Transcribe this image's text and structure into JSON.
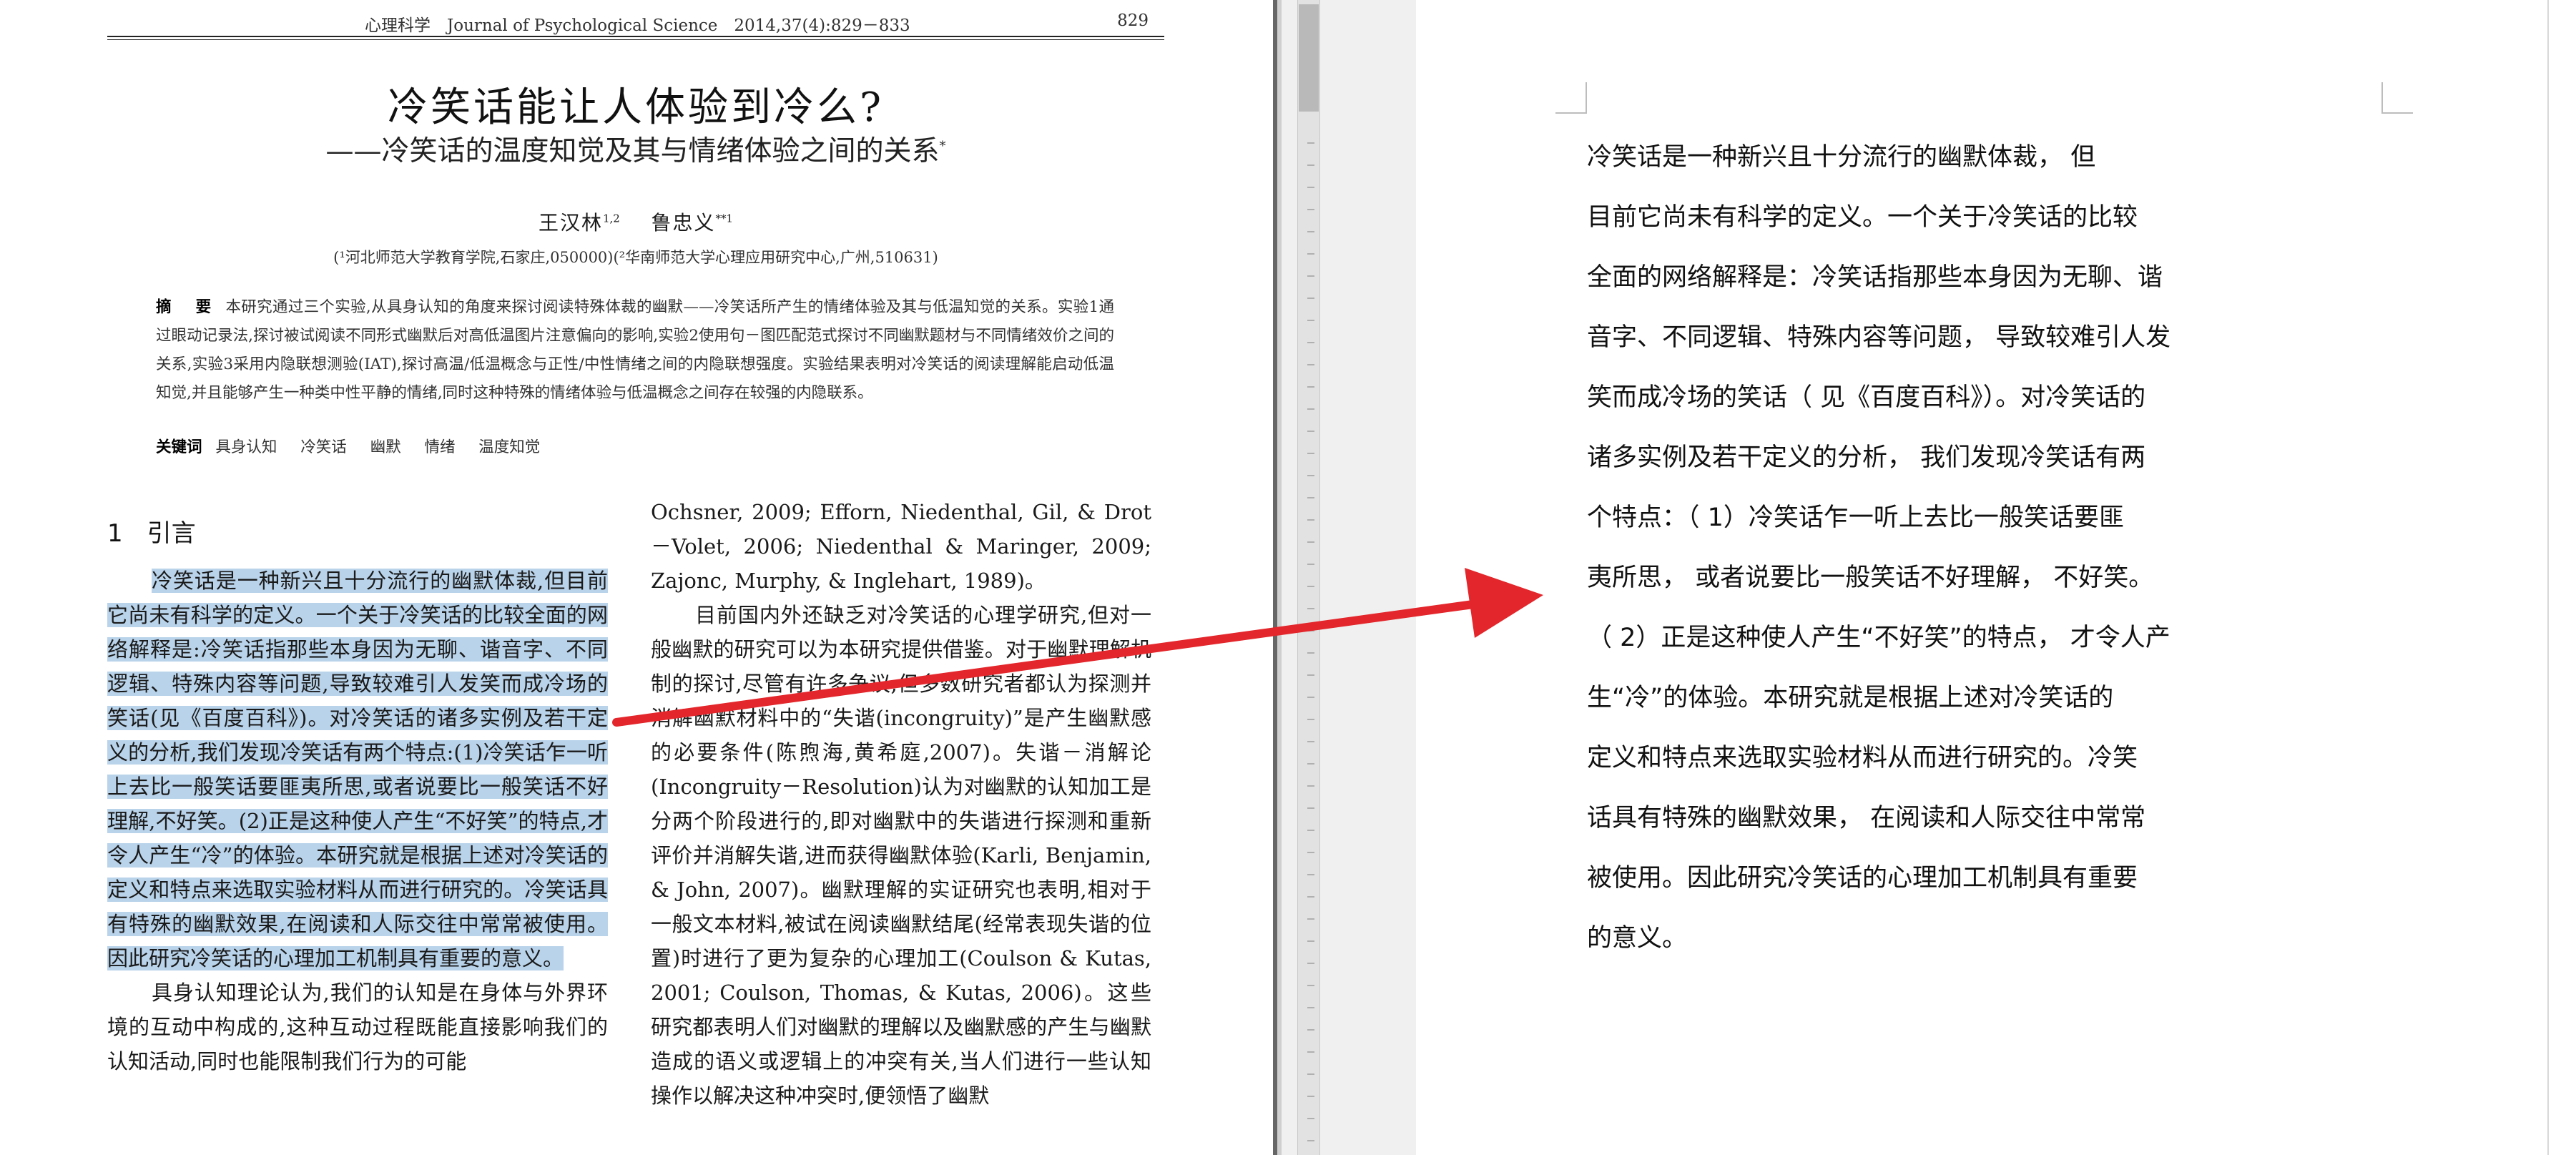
{
  "pdf": {
    "header": {
      "journal_line": "心理科学　Journal of Psychological Science　2014,37(4):829－833",
      "page_number": "829"
    },
    "title": "冷笑话能让人体验到冷么?",
    "subtitle": "——冷笑话的温度知觉及其与情绪体验之间的关系",
    "subtitle_mark": "*",
    "authors": {
      "first": "王汉林",
      "first_sup": "1,2",
      "second": "鲁忠义",
      "second_sup": "**1"
    },
    "affiliations": "(¹河北师范大学教育学院,石家庄,050000)(²华南师范大学心理应用研究中心,广州,510631)",
    "abstract_label": "摘　要",
    "abstract": "本研究通过三个实验,从具身认知的角度来探讨阅读特殊体裁的幽默——冷笑话所产生的情绪体验及其与低温知觉的关系。实验1通过眼动记录法,探讨被试阅读不同形式幽默后对高低温图片注意偏向的影响,实验2使用句－图匹配范式探讨不同幽默题材与不同情绪效价之间的关系,实验3采用内隐联想测验(IAT),探讨高温/低温概念与正性/中性情绪之间的内隐联想强度。实验结果表明对冷笑话的阅读理解能启动低温知觉,并且能够产生一种类中性平静的情绪,同时这种特殊的情绪体验与低温概念之间存在较强的内隐联系。",
    "keywords_label": "关键词",
    "keywords": [
      "具身认知",
      "冷笑话",
      "幽默",
      "情绪",
      "温度知觉"
    ],
    "section_heading": "1　引言",
    "left_col": {
      "highlighted_para": "冷笑话是一种新兴且十分流行的幽默体裁,但目前它尚未有科学的定义。一个关于冷笑话的比较全面的网络解释是:冷笑话指那些本身因为无聊、谐音字、不同逻辑、特殊内容等问题,导致较难引人发笑而成冷场的笑话(见《百度百科》)。对冷笑话的诸多实例及若干定义的分析,我们发现冷笑话有两个特点:(1)冷笑话乍一听上去比一般笑话要匪夷所思,或者说要比一般笑话不好理解,不好笑。(2)正是这种使人产生“不好笑”的特点,才令人产生“冷”的体验。本研究就是根据上述对冷笑话的定义和特点来选取实验材料从而进行研究的。冷笑话具有特殊的幽默效果,在阅读和人际交往中常常被使用。因此研究冷笑话的心理加工机制具有重要的意义。",
      "next_para": "具身认知理论认为,我们的认知是在身体与外界环境的互动中构成的,这种互动过程既能直接影响我们的认知活动,同时也能限制我们行为的可能"
    },
    "right_col": {
      "para1": "Ochsner, 2009; Efforn, Niedenthal, Gil, & Drot－Volet, 2006; Niedenthal & Maringer, 2009; Zajonc, Murphy, & Inglehart, 1989)。",
      "para2": "目前国内外还缺乏对冷笑话的心理学研究,但对一般幽默的研究可以为本研究提供借鉴。对于幽默理解机制的探讨,尽管有许多争议,但多数研究者都认为探测并消解幽默材料中的“失谐(incongruity)”是产生幽默感的必要条件(陈煦海,黄希庭,2007)。失谐－消解论(Incongruity－Resolution)认为对幽默的认知加工是分两个阶段进行的,即对幽默中的失谐进行探测和重新评价并消解失谐,进而获得幽默体验(Karli, Benjamin, & John, 2007)。幽默理解的实证研究也表明,相对于一般文本材料,被试在阅读幽默结尾(经常表现失谐的位置)时进行了更为复杂的心理加工(Coulson & Kutas, 2001; Coulson, Thomas, & Kutas, 2006)。这些研究都表明人们对幽默的理解以及幽默感的产生与幽默造成的语义或逻辑上的冲突有关,当人们进行一些认知操作以解决这种冲突时,便领悟了幽默"
    }
  },
  "doc": {
    "lines": [
      "冷笑话是一种新兴且十分流行的幽默体裁， 但",
      "目前它尚未有科学的定义。一个关于冷笑话的比较",
      "全面的网络解释是：冷笑话指那些本身因为无聊、谐",
      "音字、不同逻辑、特殊内容等问题， 导致较难引人发",
      "笑而成冷场的笑话（ 见《百度百科》）。对冷笑话的",
      "诸多实例及若干定义的分析， 我们发现冷笑话有两",
      "个特点：（ 1）冷笑话乍一听上去比一般笑话要匪",
      "夷所思， 或者说要比一般笑话不好理解， 不好笑。",
      "（ 2）正是这种使人产生“不好笑”的特点， 才令人产",
      "生“冷”的体验。本研究就是根据上述对冷笑话的",
      "定义和特点来选取实验材料从而进行研究的。冷笑",
      "话具有特殊的幽默效果， 在阅读和人际交往中常常",
      "被使用。因此研究冷笑话的心理加工机制具有重要",
      "的意义。"
    ]
  },
  "colors": {
    "highlight": "#b9d3ea",
    "arrow": "#e3262b"
  }
}
